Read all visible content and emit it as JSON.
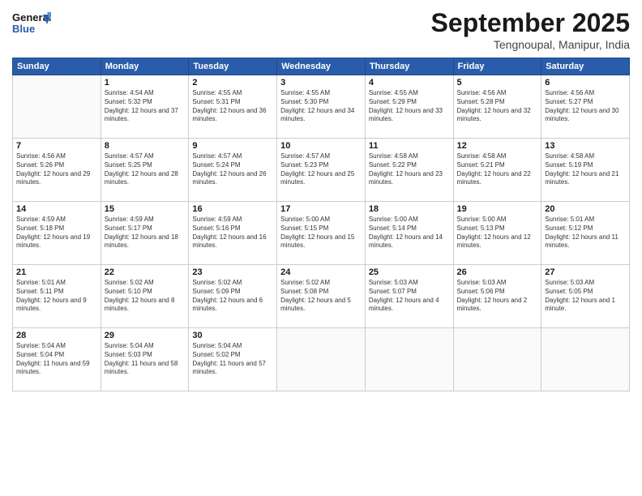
{
  "header": {
    "logo_general": "General",
    "logo_blue": "Blue",
    "month_title": "September 2025",
    "location": "Tengnoupal, Manipur, India"
  },
  "weekdays": [
    "Sunday",
    "Monday",
    "Tuesday",
    "Wednesday",
    "Thursday",
    "Friday",
    "Saturday"
  ],
  "days": [
    {
      "date": "",
      "info": ""
    },
    {
      "date": "1",
      "sunrise": "Sunrise: 4:54 AM",
      "sunset": "Sunset: 5:32 PM",
      "daylight": "Daylight: 12 hours and 37 minutes."
    },
    {
      "date": "2",
      "sunrise": "Sunrise: 4:55 AM",
      "sunset": "Sunset: 5:31 PM",
      "daylight": "Daylight: 12 hours and 36 minutes."
    },
    {
      "date": "3",
      "sunrise": "Sunrise: 4:55 AM",
      "sunset": "Sunset: 5:30 PM",
      "daylight": "Daylight: 12 hours and 34 minutes."
    },
    {
      "date": "4",
      "sunrise": "Sunrise: 4:55 AM",
      "sunset": "Sunset: 5:29 PM",
      "daylight": "Daylight: 12 hours and 33 minutes."
    },
    {
      "date": "5",
      "sunrise": "Sunrise: 4:56 AM",
      "sunset": "Sunset: 5:28 PM",
      "daylight": "Daylight: 12 hours and 32 minutes."
    },
    {
      "date": "6",
      "sunrise": "Sunrise: 4:56 AM",
      "sunset": "Sunset: 5:27 PM",
      "daylight": "Daylight: 12 hours and 30 minutes."
    },
    {
      "date": "7",
      "sunrise": "Sunrise: 4:56 AM",
      "sunset": "Sunset: 5:26 PM",
      "daylight": "Daylight: 12 hours and 29 minutes."
    },
    {
      "date": "8",
      "sunrise": "Sunrise: 4:57 AM",
      "sunset": "Sunset: 5:25 PM",
      "daylight": "Daylight: 12 hours and 28 minutes."
    },
    {
      "date": "9",
      "sunrise": "Sunrise: 4:57 AM",
      "sunset": "Sunset: 5:24 PM",
      "daylight": "Daylight: 12 hours and 26 minutes."
    },
    {
      "date": "10",
      "sunrise": "Sunrise: 4:57 AM",
      "sunset": "Sunset: 5:23 PM",
      "daylight": "Daylight: 12 hours and 25 minutes."
    },
    {
      "date": "11",
      "sunrise": "Sunrise: 4:58 AM",
      "sunset": "Sunset: 5:22 PM",
      "daylight": "Daylight: 12 hours and 23 minutes."
    },
    {
      "date": "12",
      "sunrise": "Sunrise: 4:58 AM",
      "sunset": "Sunset: 5:21 PM",
      "daylight": "Daylight: 12 hours and 22 minutes."
    },
    {
      "date": "13",
      "sunrise": "Sunrise: 4:58 AM",
      "sunset": "Sunset: 5:19 PM",
      "daylight": "Daylight: 12 hours and 21 minutes."
    },
    {
      "date": "14",
      "sunrise": "Sunrise: 4:59 AM",
      "sunset": "Sunset: 5:18 PM",
      "daylight": "Daylight: 12 hours and 19 minutes."
    },
    {
      "date": "15",
      "sunrise": "Sunrise: 4:59 AM",
      "sunset": "Sunset: 5:17 PM",
      "daylight": "Daylight: 12 hours and 18 minutes."
    },
    {
      "date": "16",
      "sunrise": "Sunrise: 4:59 AM",
      "sunset": "Sunset: 5:16 PM",
      "daylight": "Daylight: 12 hours and 16 minutes."
    },
    {
      "date": "17",
      "sunrise": "Sunrise: 5:00 AM",
      "sunset": "Sunset: 5:15 PM",
      "daylight": "Daylight: 12 hours and 15 minutes."
    },
    {
      "date": "18",
      "sunrise": "Sunrise: 5:00 AM",
      "sunset": "Sunset: 5:14 PM",
      "daylight": "Daylight: 12 hours and 14 minutes."
    },
    {
      "date": "19",
      "sunrise": "Sunrise: 5:00 AM",
      "sunset": "Sunset: 5:13 PM",
      "daylight": "Daylight: 12 hours and 12 minutes."
    },
    {
      "date": "20",
      "sunrise": "Sunrise: 5:01 AM",
      "sunset": "Sunset: 5:12 PM",
      "daylight": "Daylight: 12 hours and 11 minutes."
    },
    {
      "date": "21",
      "sunrise": "Sunrise: 5:01 AM",
      "sunset": "Sunset: 5:11 PM",
      "daylight": "Daylight: 12 hours and 9 minutes."
    },
    {
      "date": "22",
      "sunrise": "Sunrise: 5:02 AM",
      "sunset": "Sunset: 5:10 PM",
      "daylight": "Daylight: 12 hours and 8 minutes."
    },
    {
      "date": "23",
      "sunrise": "Sunrise: 5:02 AM",
      "sunset": "Sunset: 5:09 PM",
      "daylight": "Daylight: 12 hours and 6 minutes."
    },
    {
      "date": "24",
      "sunrise": "Sunrise: 5:02 AM",
      "sunset": "Sunset: 5:08 PM",
      "daylight": "Daylight: 12 hours and 5 minutes."
    },
    {
      "date": "25",
      "sunrise": "Sunrise: 5:03 AM",
      "sunset": "Sunset: 5:07 PM",
      "daylight": "Daylight: 12 hours and 4 minutes."
    },
    {
      "date": "26",
      "sunrise": "Sunrise: 5:03 AM",
      "sunset": "Sunset: 5:06 PM",
      "daylight": "Daylight: 12 hours and 2 minutes."
    },
    {
      "date": "27",
      "sunrise": "Sunrise: 5:03 AM",
      "sunset": "Sunset: 5:05 PM",
      "daylight": "Daylight: 12 hours and 1 minute."
    },
    {
      "date": "28",
      "sunrise": "Sunrise: 5:04 AM",
      "sunset": "Sunset: 5:04 PM",
      "daylight": "Daylight: 11 hours and 59 minutes."
    },
    {
      "date": "29",
      "sunrise": "Sunrise: 5:04 AM",
      "sunset": "Sunset: 5:03 PM",
      "daylight": "Daylight: 11 hours and 58 minutes."
    },
    {
      "date": "30",
      "sunrise": "Sunrise: 5:04 AM",
      "sunset": "Sunset: 5:02 PM",
      "daylight": "Daylight: 11 hours and 57 minutes."
    },
    {
      "date": "",
      "info": ""
    },
    {
      "date": "",
      "info": ""
    },
    {
      "date": "",
      "info": ""
    },
    {
      "date": "",
      "info": ""
    },
    {
      "date": "",
      "info": ""
    }
  ]
}
